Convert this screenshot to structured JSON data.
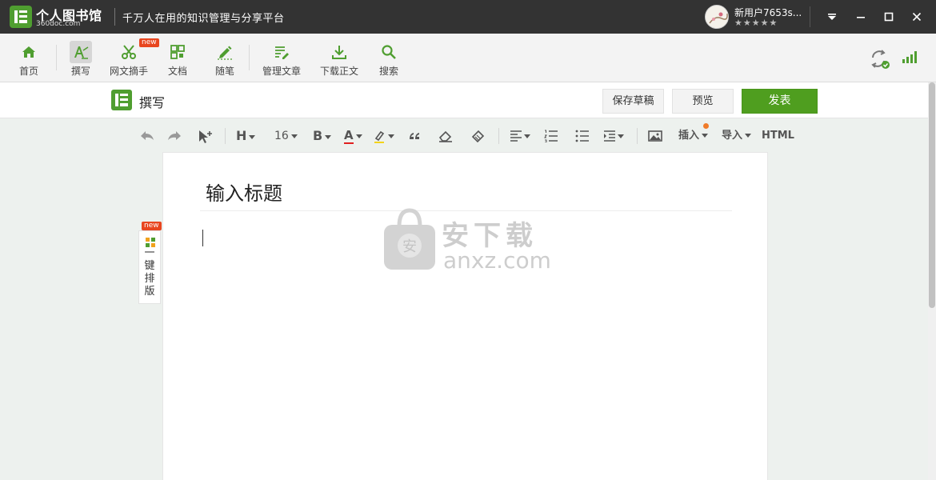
{
  "titlebar": {
    "brand_name": "个人图书馆",
    "brand_url": "360doc.com",
    "slogan": "千万人在用的知识管理与分享平台",
    "user_name": "新用户7653s...",
    "stars": "★★★★★"
  },
  "toolbar": {
    "items": [
      {
        "label": "首页",
        "icon": "home-icon"
      },
      {
        "label": "撰写",
        "icon": "write-icon"
      },
      {
        "label": "网文摘手",
        "icon": "scissors-icon",
        "badge": "new"
      },
      {
        "label": "文档",
        "icon": "document-icon"
      },
      {
        "label": "随笔",
        "icon": "pen-icon"
      },
      {
        "label": "管理文章",
        "icon": "manage-articles-icon"
      },
      {
        "label": "下载正文",
        "icon": "download-icon"
      },
      {
        "label": "搜索",
        "icon": "search-icon"
      }
    ]
  },
  "writebar": {
    "title": "撰写",
    "save_draft": "保存草稿",
    "preview": "预览",
    "publish": "发表"
  },
  "format": {
    "heading": "H",
    "font_size": "16",
    "bold": "B",
    "font_color": "A",
    "insert": "插入",
    "import": "导入",
    "html": "HTML"
  },
  "editor": {
    "title_placeholder": "输入标题"
  },
  "sidetab": {
    "badge": "new",
    "label_lines": [
      "一",
      "键",
      "排",
      "版"
    ]
  },
  "watermark": {
    "text": "安下载",
    "url": "anxz.com"
  },
  "colors": {
    "brand_green": "#4f9e30",
    "publish_green": "#4f9e1f",
    "titlebar_bg": "#333333",
    "badge_red": "#e8461f"
  }
}
